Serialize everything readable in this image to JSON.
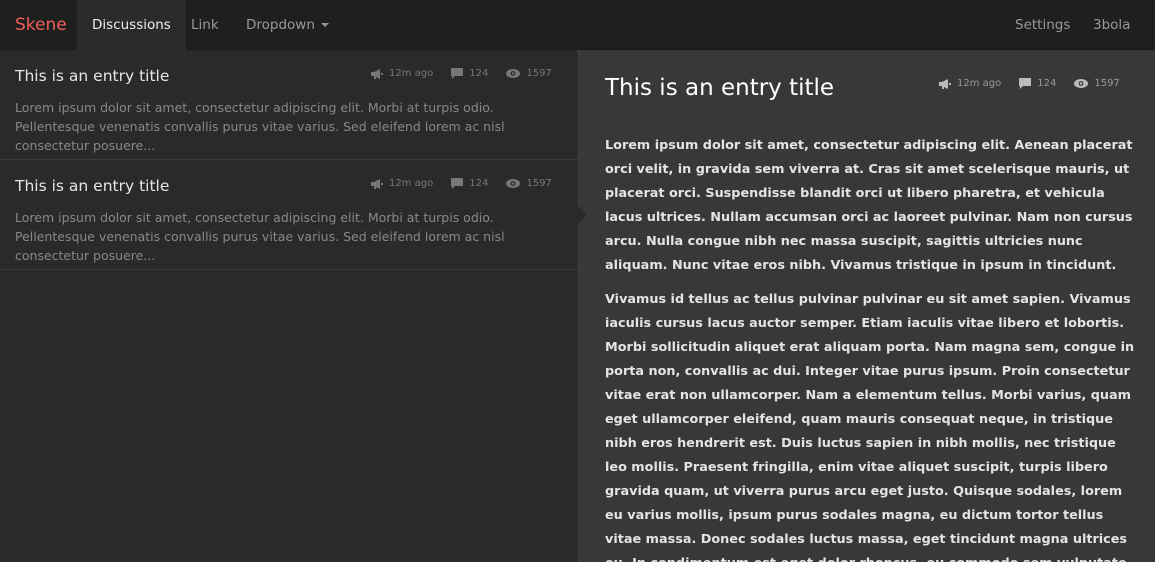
{
  "navbar": {
    "brand": "Skene",
    "brand_color": "#ee5f5b",
    "left_items": [
      {
        "label": "Discussions",
        "active": true
      },
      {
        "label": "Link",
        "active": false
      },
      {
        "label": "Dropdown",
        "active": false,
        "has_caret": true
      }
    ],
    "right_items": [
      {
        "label": "Settings"
      },
      {
        "label": "3bola",
        "has_caret": true
      }
    ]
  },
  "entries": [
    {
      "title": "This is an entry title",
      "excerpt": "Lorem ipsum dolor sit amet, consectetur adipiscing elit. Morbi at turpis odio. Pellentesque venenatis convallis purus vitae varius. Sed eleifend lorem ac nisl consectetur posuere...",
      "time": "12m ago",
      "comments": "124",
      "views": "1597"
    },
    {
      "title": "This is an entry title",
      "excerpt": "Lorem ipsum dolor sit amet, consectetur adipiscing elit. Morbi at turpis odio. Pellentesque venenatis convallis purus vitae varius. Sed eleifend lorem ac nisl consectetur posuere...",
      "time": "12m ago",
      "comments": "124",
      "views": "1597"
    }
  ],
  "detail": {
    "title": "This is an entry title",
    "time": "12m ago",
    "comments": "124",
    "views": "1597",
    "paragraphs": [
      "Lorem ipsum dolor sit amet, consectetur adipiscing elit. Aenean placerat orci velit, in gravida sem viverra at. Cras sit amet scelerisque mauris, ut placerat orci. Suspendisse blandit orci ut libero pharetra, et vehicula lacus ultrices. Nullam accumsan orci ac laoreet pulvinar. Nam non cursus arcu. Nulla congue nibh nec massa suscipit, sagittis ultricies nunc aliquam. Nunc vitae eros nibh. Vivamus tristique in ipsum in tincidunt.",
      "Vivamus id tellus ac tellus pulvinar pulvinar eu sit amet sapien. Vivamus iaculis cursus lacus auctor semper. Etiam iaculis vitae libero et lobortis. Morbi sollicitudin aliquet erat aliquam porta. Nam magna sem, congue in porta non, convallis ac dui. Integer vitae purus ipsum. Proin consectetur vitae erat non ullamcorper. Nam a elementum tellus. Morbi varius, quam eget ullamcorper eleifend, quam mauris consequat neque, in tristique nibh eros hendrerit est. Duis luctus sapien in nibh mollis, nec tristique leo mollis. Praesent fringilla, enim vitae aliquet suscipit, turpis libero gravida quam, ut viverra purus arcu eget justo. Quisque sodales, lorem eu varius mollis, ipsum purus sodales magna, eu dictum tortor tellus vitae massa. Donec sodales luctus massa, eget tincidunt magna ultrices eu. In condimentum est eget dolor rhoncus, eu commodo sem vulputate."
    ]
  },
  "icons": {
    "time": "megaphone-icon",
    "comments": "comment-bubble-icon",
    "views": "eye-icon"
  }
}
